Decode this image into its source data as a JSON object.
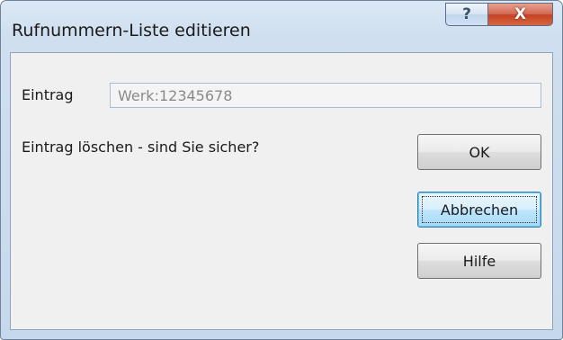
{
  "window": {
    "title": "Rufnummern-Liste editieren",
    "help_glyph": "?",
    "close_glyph": "X"
  },
  "form": {
    "entry_label": "Eintrag",
    "entry_value": "Werk:12345678",
    "question": "Eintrag löschen - sind Sie sicher?"
  },
  "buttons": {
    "ok": "OK",
    "cancel": "Abbrechen",
    "help": "Hilfe"
  },
  "icons": {
    "help": "question-mark-icon",
    "close": "close-x-icon"
  },
  "colors": {
    "close_button": "#c44126",
    "focus_button": "#3c7fb1",
    "titlebar": "#dbe8f5"
  }
}
